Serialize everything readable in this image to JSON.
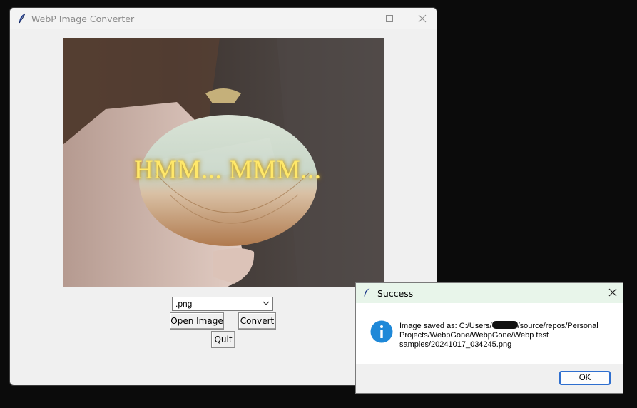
{
  "window": {
    "title": "WebP Image Converter",
    "icon": "feather-icon",
    "controls": [
      "minimize-icon",
      "maximize-icon",
      "close-icon"
    ]
  },
  "preview": {
    "caption": "HMM... MMM..."
  },
  "format_select": {
    "value": ".png"
  },
  "buttons": {
    "open": "Open Image",
    "convert": "Convert",
    "quit": "Quit"
  },
  "dialog": {
    "title": "Success",
    "icon": "info-icon",
    "message_prefix": "Image saved as: C:/Users/",
    "message_suffix": "/source/repos/Personal Projects/WebpGone/WebpGone/Webp test samples/20241017_034245.png",
    "ok": "OK"
  },
  "colors": {
    "accent": "#2f6fcf",
    "info": "#1e88d8",
    "dialog_titlebar": "#e8f5ea"
  }
}
